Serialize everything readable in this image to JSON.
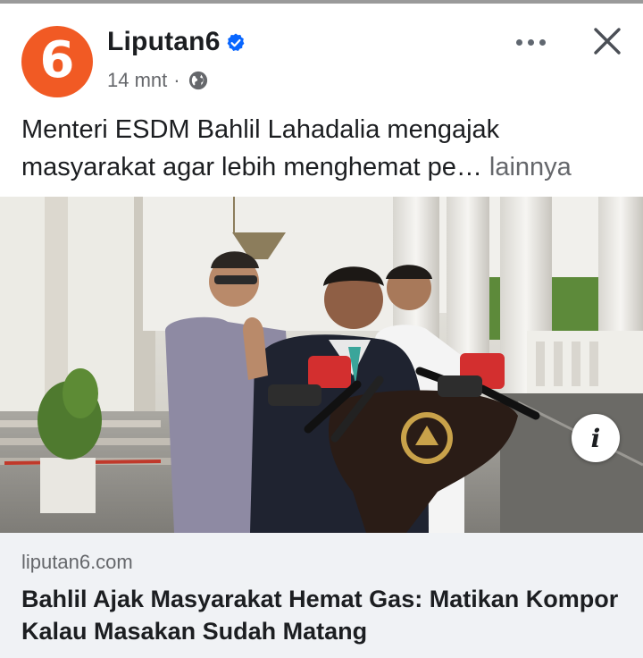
{
  "post": {
    "page_name": "Liputan6",
    "avatar_text": "6",
    "timestamp": "14 mnt",
    "meta_separator": "·",
    "caption": "Menteri ESDM Bahlil Lahadalia mengajak masyarakat agar lebih menghemat pe…",
    "see_more": "lainnya"
  },
  "photo": {
    "info_label": "i"
  },
  "link": {
    "domain": "liputan6.com",
    "headline": "Bahlil Ajak Masyarakat Hemat Gas: Matikan Kompor Kalau Masakan Sudah Matang"
  },
  "colors": {
    "brand_orange": "#f15a24",
    "verified_blue": "#0866ff",
    "secondary_text": "#65676b",
    "card_bg": "#f0f2f5"
  },
  "icons": [
    "verified-badge-icon",
    "globe-icon",
    "more-options-icon",
    "close-icon",
    "info-icon"
  ]
}
